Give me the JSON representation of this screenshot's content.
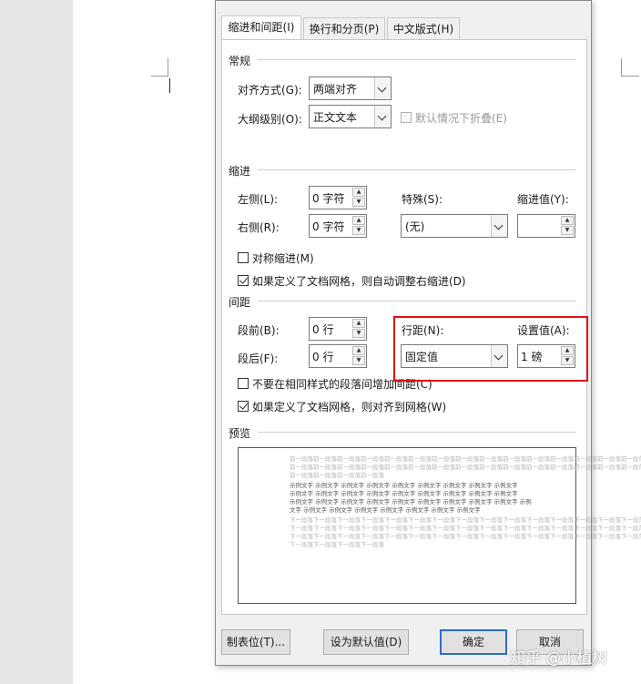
{
  "tabs": [
    "缩进和间距(I)",
    "换行和分页(P)",
    "中文版式(H)"
  ],
  "general": {
    "title": "常规",
    "alignment_label": "对齐方式(G):",
    "alignment_value": "两端对齐",
    "outline_label": "大纲级别(O):",
    "outline_value": "正文文本",
    "collapse_label": "默认情况下折叠(E)"
  },
  "indent": {
    "title": "缩进",
    "left_label": "左侧(L):",
    "left_value": "0 字符",
    "right_label": "右侧(R):",
    "right_value": "0 字符",
    "special_label": "特殊(S):",
    "special_value": "(无)",
    "amount_label": "缩进值(Y):",
    "amount_value": "",
    "mirror_label": "对称缩进(M)",
    "auto_adjust_label": "如果定义了文档网格，则自动调整右缩进(D)"
  },
  "spacing": {
    "title": "间距",
    "before_label": "段前(B):",
    "before_value": "0 行",
    "after_label": "段后(F):",
    "after_value": "0 行",
    "line_label": "行距(N):",
    "line_value": "固定值",
    "at_label": "设置值(A):",
    "at_value": "1 磅",
    "no_space_label": "不要在相同样式的段落间增加间距(C)",
    "snap_grid_label": "如果定义了文档网格，则对齐到网格(W)"
  },
  "preview": {
    "title": "预览",
    "prev_lines": [
      "前一段落前一段落前一段落前一段落前一段落前一段落前一段落前一段落前一段落前一段落前一段落前一段落前一段落前一段落前一段落",
      "前一段落前一段落前一段落前一段落前一段落前一段落前一段落前一段落前一段落前一段落前一段落前一段落前一段落前一段落前一段落",
      "前一段落前一段落前一段落前一段落"
    ],
    "sample_lines": [
      "示例文字 示例文字 示例文字 示例文字 示例文字 示例文字 示例文字 示例文字 示例文字",
      "示例文字 示例文字 示例文字 示例文字 示例文字 示例文字 示例文字 示例文字 示例文字",
      "示例文字 示例文字 示例文字 示例文字 示例文字 示例文字 示例文字 示例文字 示例文字 示例",
      "文字 示例文字 示例文字 示例文字 示例文字 示例文字 示例文字 示例文字"
    ],
    "next_lines": [
      "下一段落下一段落下一段落下一段落下一段落下一段落下一段落下一段落下一段落下一段落下一段落下一段落下一段落下一段落下一段落",
      "下一段落下一段落下一段落下一段落下一段落下一段落下一段落下一段落下一段落下一段落下一段落下一段落下一段落下一段落下一段落",
      "下一段落下一段落下一段落下一段落下一段落下一段落下一段落下一段落下一段落下一段落下一段落下一段落下一段落下一段落下一段落",
      "下一段落下一段落下一段落下一段落"
    ]
  },
  "buttons": {
    "tabs": "制表位(T)...",
    "set_default": "设为默认值(D)",
    "ok": "确定",
    "cancel": "取消"
  },
  "watermark": "知乎 @小植树",
  "colors": {
    "highlight": "#e01010",
    "ok_border": "#2a6fc9"
  }
}
